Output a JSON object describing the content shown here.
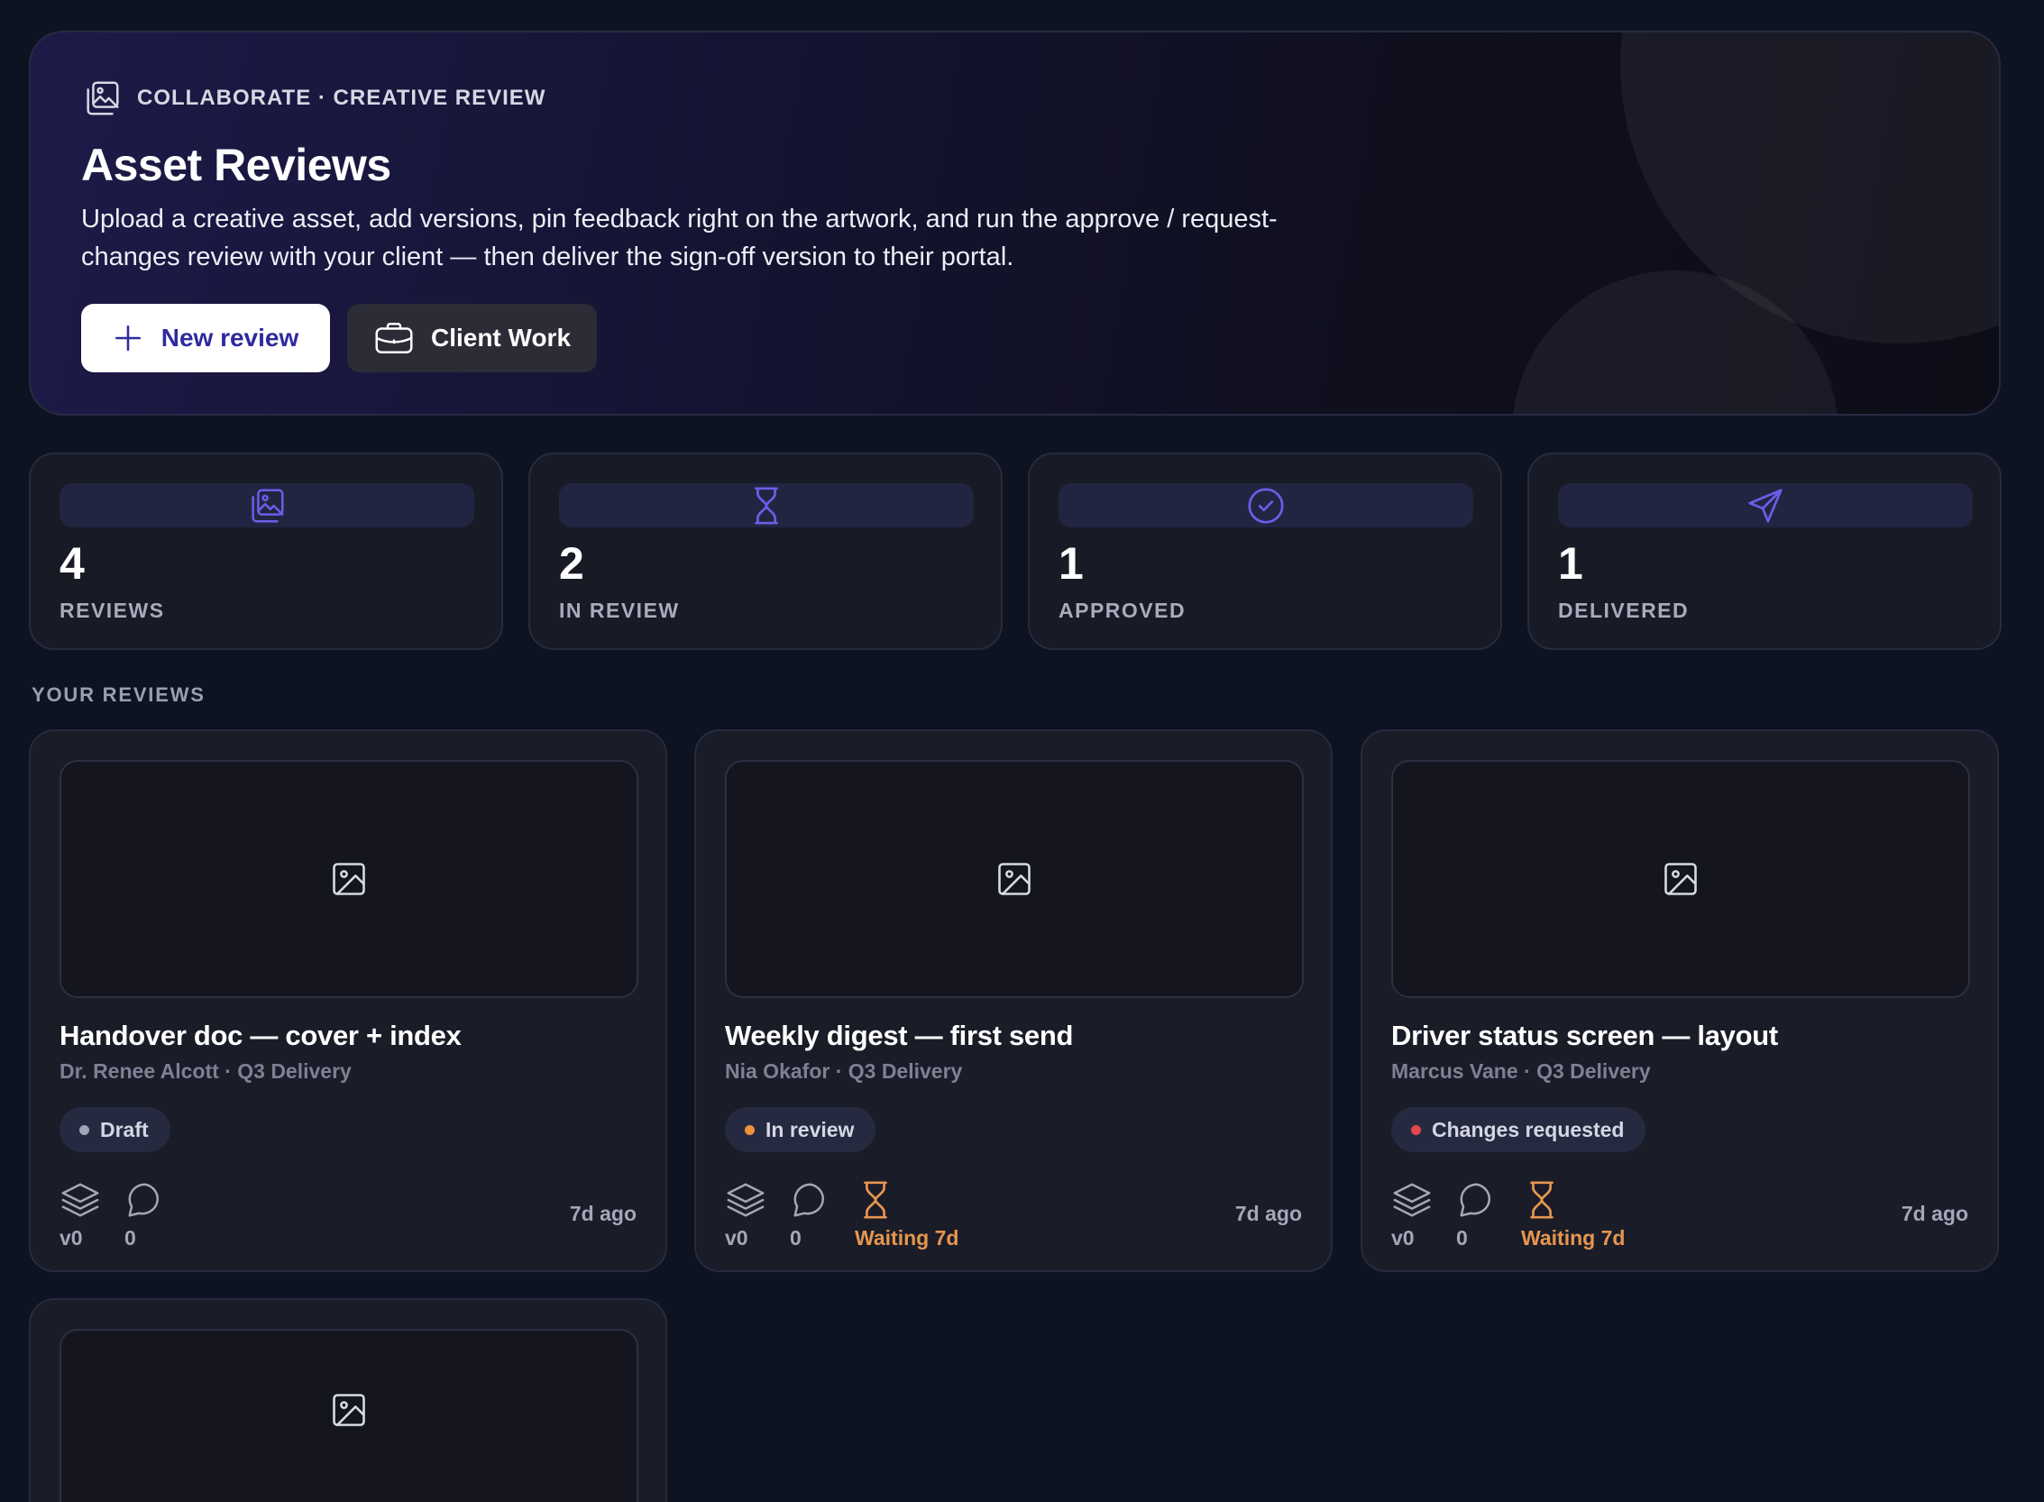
{
  "hero": {
    "eyebrow": "COLLABORATE · CREATIVE REVIEW",
    "title": "Asset Reviews",
    "description": "Upload a creative asset, add versions, pin feedback right on the artwork, and run the approve / request-changes review with your client — then deliver the sign-off version to their portal.",
    "primary_button": "New review",
    "secondary_button": "Client Work"
  },
  "stats": [
    {
      "value": "4",
      "label": "REVIEWS",
      "icon": "image-stack-icon"
    },
    {
      "value": "2",
      "label": "IN REVIEW",
      "icon": "hourglass-icon"
    },
    {
      "value": "1",
      "label": "APPROVED",
      "icon": "check-circle-icon"
    },
    {
      "value": "1",
      "label": "DELIVERED",
      "icon": "send-icon"
    }
  ],
  "section_title": "YOUR REVIEWS",
  "reviews": [
    {
      "title": "Handover doc — cover + index",
      "subtitle": "Dr. Renee Alcott · Q3 Delivery",
      "status": "Draft",
      "status_color": "#a0a4b8",
      "versions": "v0",
      "comments": "0",
      "waiting": null,
      "age": "7d ago"
    },
    {
      "title": "Weekly digest — first send",
      "subtitle": "Nia Okafor · Q3 Delivery",
      "status": "In review",
      "status_color": "#f0923a",
      "versions": "v0",
      "comments": "0",
      "waiting": "Waiting 7d",
      "age": "7d ago"
    },
    {
      "title": "Driver status screen — layout",
      "subtitle": "Marcus Vane · Q3 Delivery",
      "status": "Changes requested",
      "status_color": "#e5484d",
      "versions": "v0",
      "comments": "0",
      "waiting": "Waiting 7d",
      "age": "7d ago"
    }
  ],
  "colors": {
    "accent": "#6a5ee8",
    "waiting": "#e69650",
    "background": "#0e1322"
  }
}
